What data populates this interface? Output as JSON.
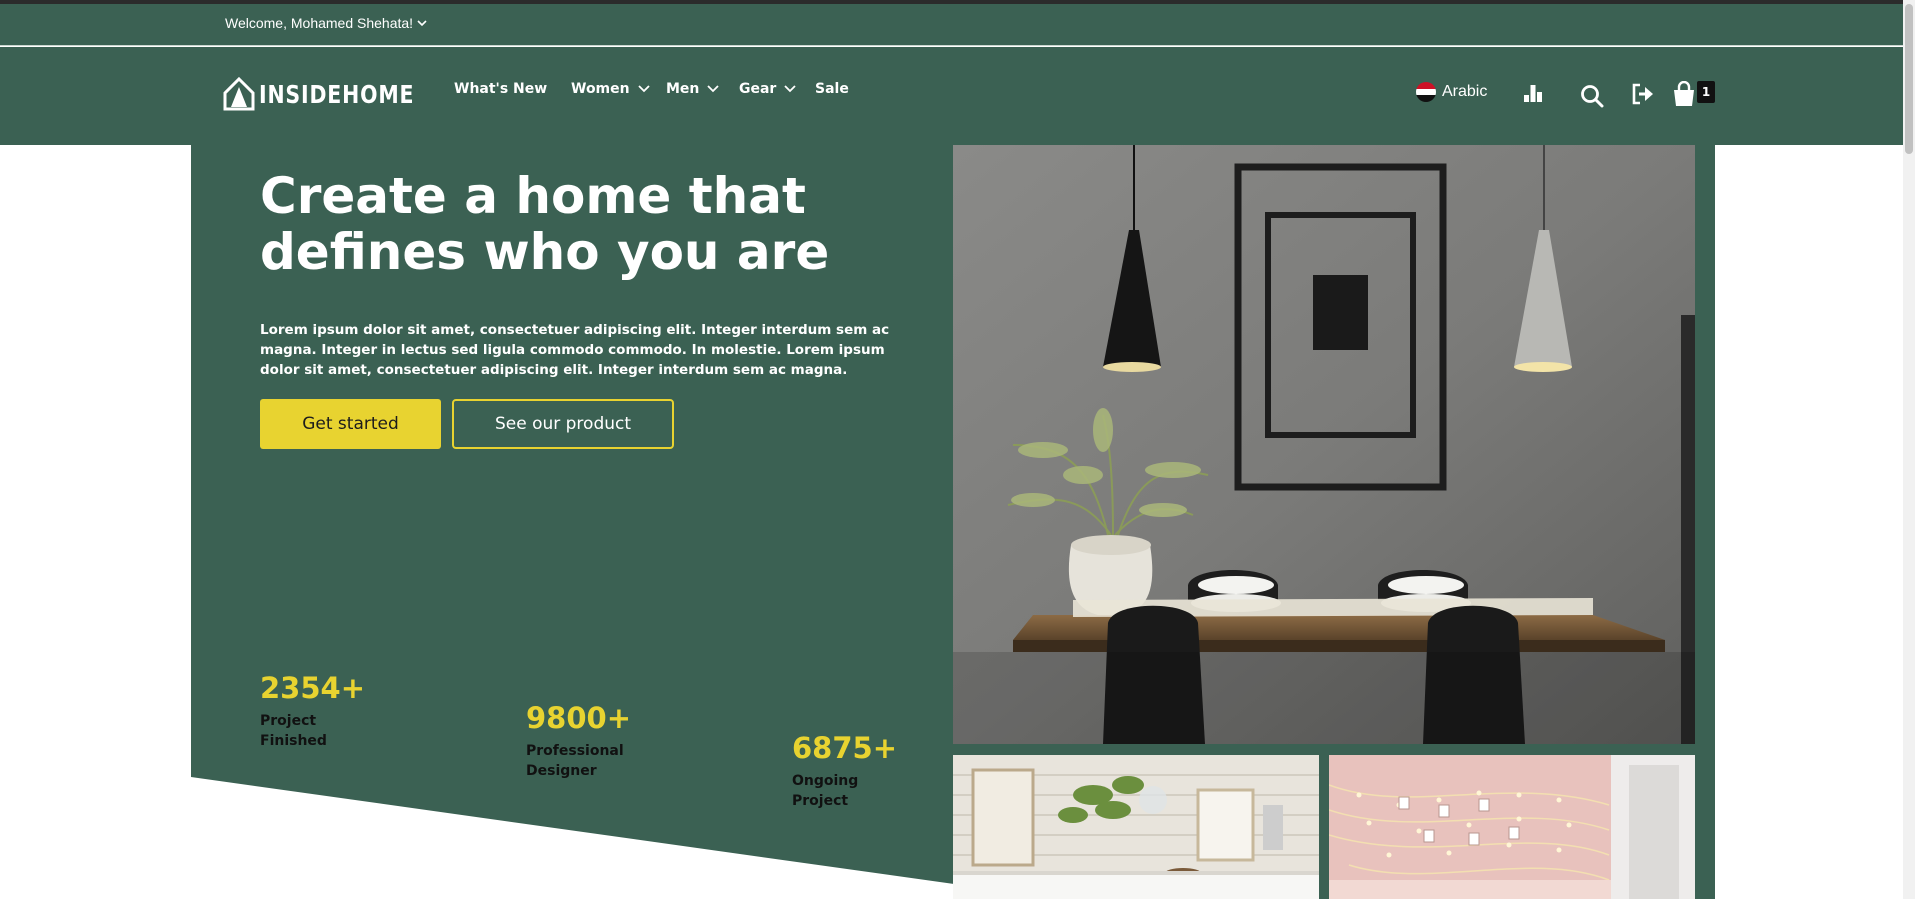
{
  "topbar": {
    "welcome": "Welcome, Mohamed Shehata!"
  },
  "brand": {
    "name": "INSIDEHOME"
  },
  "nav": {
    "items": [
      {
        "label": "What's New",
        "has_dropdown": false
      },
      {
        "label": "Women",
        "has_dropdown": true
      },
      {
        "label": "Men",
        "has_dropdown": true
      },
      {
        "label": "Gear",
        "has_dropdown": true
      },
      {
        "label": "Sale",
        "has_dropdown": false
      }
    ]
  },
  "tools": {
    "language": "Arabic",
    "cart_count": "1"
  },
  "hero": {
    "title": "Create a home that defines who you are",
    "description": "Lorem ipsum dolor sit amet, consectetuer adipiscing elit. Integer interdum sem ac magna. Integer in lectus sed ligula commodo commodo. In molestie. Lorem ipsum dolor sit amet, consectetuer adipiscing elit. Integer interdum sem ac magna.",
    "primary_button": "Get started",
    "secondary_button": "See our product"
  },
  "stats": [
    {
      "value": "2354+",
      "label": "Project Finished"
    },
    {
      "value": "9800+",
      "label": "Professional Designer"
    },
    {
      "value": "6875+",
      "label": "Ongoing Project"
    }
  ],
  "colors": {
    "primary_green": "#3b6153",
    "accent_yellow": "#e8d330",
    "text_white": "#ffffff"
  }
}
